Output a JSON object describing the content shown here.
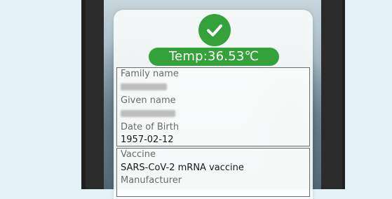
{
  "status": {
    "icon": "checkmark-icon",
    "color": "#34a13a",
    "temperature_label": "Temp:36.53℃"
  },
  "person": {
    "family_name_label": "Family name",
    "given_name_label": "Given name",
    "dob_label": "Date of Birth",
    "dob_value": "1957-02-12"
  },
  "vaccine": {
    "vaccine_label": "Vaccine",
    "vaccine_value": "SARS-CoV-2 mRNA vaccine",
    "manufacturer_label": "Manufacturer"
  }
}
